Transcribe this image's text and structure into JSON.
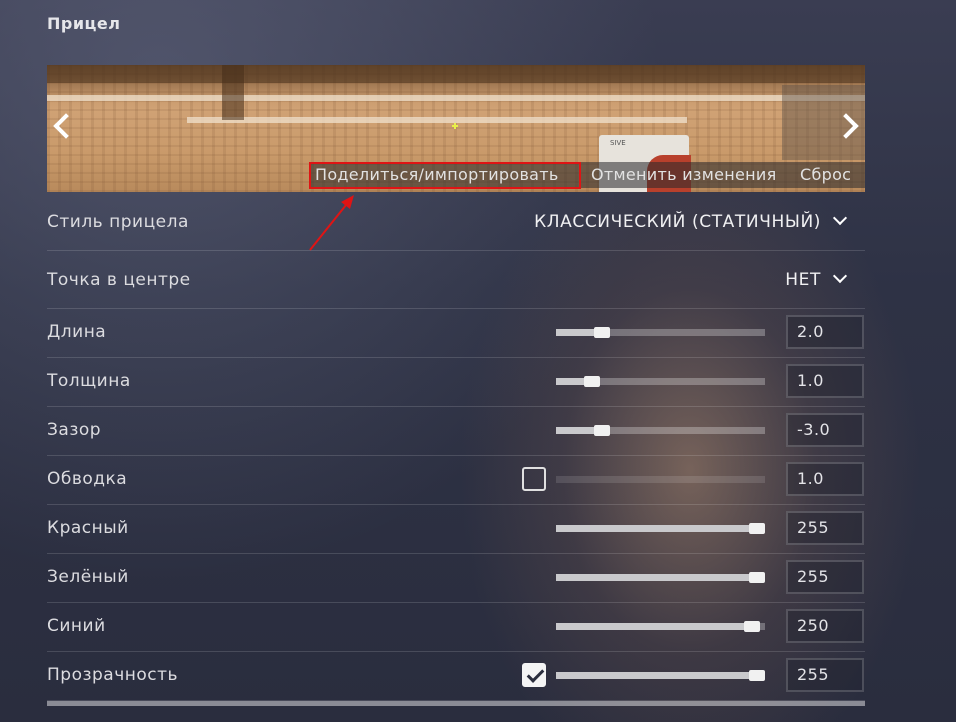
{
  "section": {
    "title": "Прицел"
  },
  "preview": {
    "share_import_label": "Поделиться/импортировать",
    "cancel_changes_label": "Отменить изменения",
    "reset_label": "Сброс",
    "sign_text": "SIVE"
  },
  "settings": {
    "style": {
      "label": "Стиль прицела",
      "value": "КЛАССИЧЕСКИЙ (СТАТИЧНЫЙ)"
    },
    "center_dot": {
      "label": "Точка в центре",
      "value": "НЕТ"
    },
    "sliders": [
      {
        "key": "length",
        "label": "Длина",
        "value": "2.0",
        "fraction": 0.22,
        "checkbox": null,
        "disabled": false
      },
      {
        "key": "thickness",
        "label": "Толщина",
        "value": "1.0",
        "fraction": 0.17,
        "checkbox": null,
        "disabled": false
      },
      {
        "key": "gap",
        "label": "Зазор",
        "value": "-3.0",
        "fraction": 0.22,
        "checkbox": null,
        "disabled": false
      },
      {
        "key": "outline",
        "label": "Обводка",
        "value": "1.0",
        "fraction": 0.0,
        "checkbox": false,
        "disabled": true
      },
      {
        "key": "red",
        "label": "Красный",
        "value": "255",
        "fraction": 0.96,
        "checkbox": null,
        "disabled": false
      },
      {
        "key": "green",
        "label": "Зелёный",
        "value": "255",
        "fraction": 0.96,
        "checkbox": null,
        "disabled": false
      },
      {
        "key": "blue",
        "label": "Синий",
        "value": "250",
        "fraction": 0.94,
        "checkbox": null,
        "disabled": false
      },
      {
        "key": "alpha",
        "label": "Прозрачность",
        "value": "255",
        "fraction": 0.96,
        "checkbox": true,
        "disabled": false
      }
    ]
  },
  "colors": {
    "highlight": "#e01414",
    "crosshair": "#e8f04a"
  },
  "icons": {
    "preview_prev": "chevron-left-icon",
    "preview_next": "chevron-right-icon",
    "dropdown": "chevron-down-icon",
    "checkbox_checked": "checkmark-icon"
  }
}
